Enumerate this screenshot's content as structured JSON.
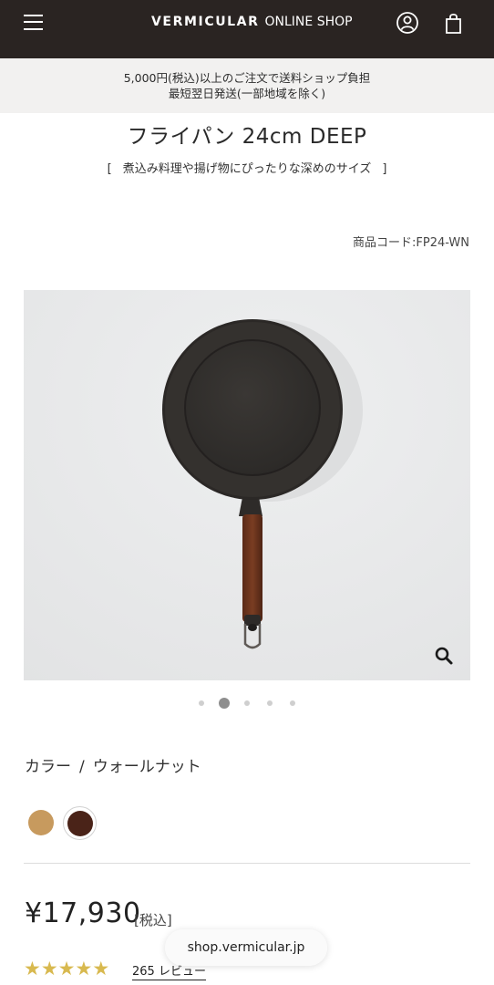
{
  "header": {
    "brand": "VERMICULAR",
    "shop": "ONLINE SHOP",
    "menu_icon": "hamburger-menu-icon",
    "account_icon": "user-circle-icon",
    "cart_icon": "shopping-bag-icon",
    "background_color": "#2a2422"
  },
  "notice": {
    "line1": "5,000円(税込)以上のご注文で送料ショップ負担",
    "line2": "最短翌日発送(一部地域を除く)"
  },
  "product": {
    "title": "フライパン 24cm DEEP",
    "subtitle_open": "[",
    "subtitle_text": "煮込み料理や揚げ物にぴったりな深めのサイズ",
    "subtitle_close": "]",
    "code": "商品コード:FP24-WN",
    "zoom_icon": "magnifier-icon",
    "gallery": {
      "count": 5,
      "active_index": 1
    },
    "color_label": "カラー",
    "color_separator": "/",
    "color_value": "ウォールナット",
    "swatches": [
      {
        "name": "natural",
        "color": "#c79a5e",
        "selected": false
      },
      {
        "name": "walnut",
        "color": "#4a2318",
        "selected": true
      }
    ],
    "price": "¥17,930",
    "tax": "[税込]",
    "rating": {
      "stars": 5,
      "star_color": "#d8b94f"
    },
    "reviews": "265 レビュー"
  },
  "browser": {
    "url": "shop.vermicular.jp"
  }
}
